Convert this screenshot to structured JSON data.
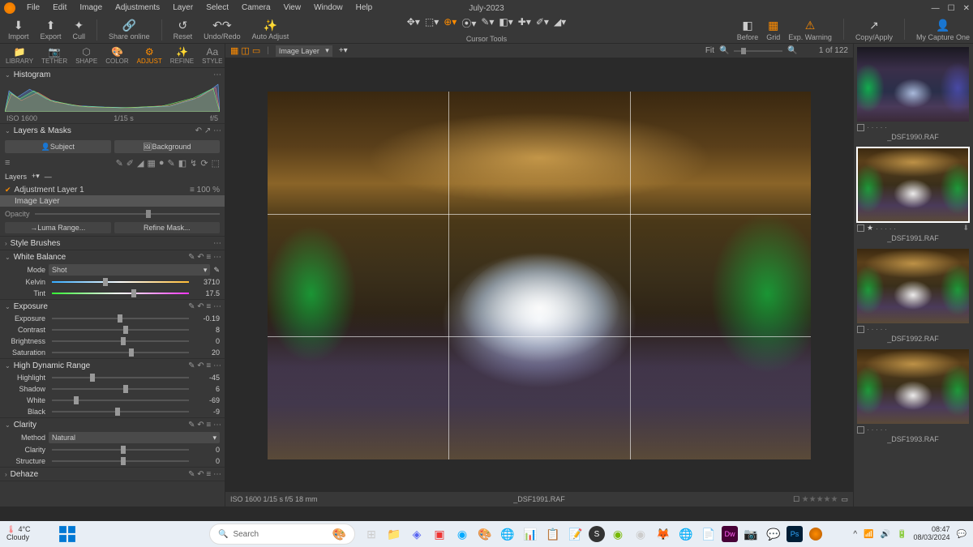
{
  "title": "July-2023",
  "menu": [
    "File",
    "Edit",
    "Image",
    "Adjustments",
    "Layer",
    "Select",
    "Camera",
    "View",
    "Window",
    "Help"
  ],
  "toolbar": {
    "import": "Import",
    "export": "Export",
    "cull": "Cull",
    "share": "Share online",
    "reset": "Reset",
    "undo": "Undo/Redo",
    "auto": "Auto Adjust",
    "cursor": "Cursor Tools",
    "before": "Before",
    "grid": "Grid",
    "expw": "Exp. Warning",
    "copy": "Copy/Apply",
    "mycap": "My Capture One"
  },
  "tooltabs": [
    "LIBRARY",
    "TETHER",
    "SHAPE",
    "COLOR",
    "ADJUST",
    "REFINE",
    "STYLE"
  ],
  "histogram": {
    "title": "Histogram",
    "iso": "ISO 1600",
    "shutter": "1/15 s",
    "aperture": "f/5"
  },
  "layers": {
    "title": "Layers & Masks",
    "subject": "Subject",
    "background": "Background",
    "label": "Layers",
    "adj": "Adjustment Layer 1",
    "adjpct": "100 %",
    "base": "Image Layer",
    "opacity": "Opacity",
    "luma": "Luma Range...",
    "refine": "Refine Mask..."
  },
  "stylebrushes": "Style Brushes",
  "wb": {
    "title": "White Balance",
    "mode": "Mode",
    "modeval": "Shot",
    "kelvin": "Kelvin",
    "kelvinval": "3710",
    "tint": "Tint",
    "tintval": "17.5"
  },
  "exposure": {
    "title": "Exposure",
    "exp": "Exposure",
    "expval": "-0.19",
    "con": "Contrast",
    "conval": "8",
    "bri": "Brightness",
    "brival": "0",
    "sat": "Saturation",
    "satval": "20"
  },
  "hdr": {
    "title": "High Dynamic Range",
    "hl": "Highlight",
    "hlval": "-45",
    "sh": "Shadow",
    "shval": "6",
    "wh": "White",
    "whval": "-69",
    "bl": "Black",
    "blval": "-9"
  },
  "clarity": {
    "title": "Clarity",
    "method": "Method",
    "methodval": "Natural",
    "cl": "Clarity",
    "clval": "0",
    "st": "Structure",
    "stval": "0"
  },
  "dehaze": "Dehaze",
  "viewer": {
    "layerdd": "Image Layer",
    "fit": "Fit",
    "counter": "1 of 122",
    "meta_left": "ISO 1600    1/15 s    f/5    18 mm",
    "filename": "_DSF1991.RAF"
  },
  "thumbs": [
    {
      "name": "_DSF1990.RAF",
      "sel": false,
      "alt": true
    },
    {
      "name": "_DSF1991.RAF",
      "sel": true,
      "alt": false
    },
    {
      "name": "_DSF1992.RAF",
      "sel": false,
      "alt": false
    },
    {
      "name": "_DSF1993.RAF",
      "sel": false,
      "alt": false
    }
  ],
  "taskbar": {
    "temp": "4°C",
    "cond": "Cloudy",
    "search": "Search",
    "time": "08:47",
    "date": "08/03/2024"
  }
}
